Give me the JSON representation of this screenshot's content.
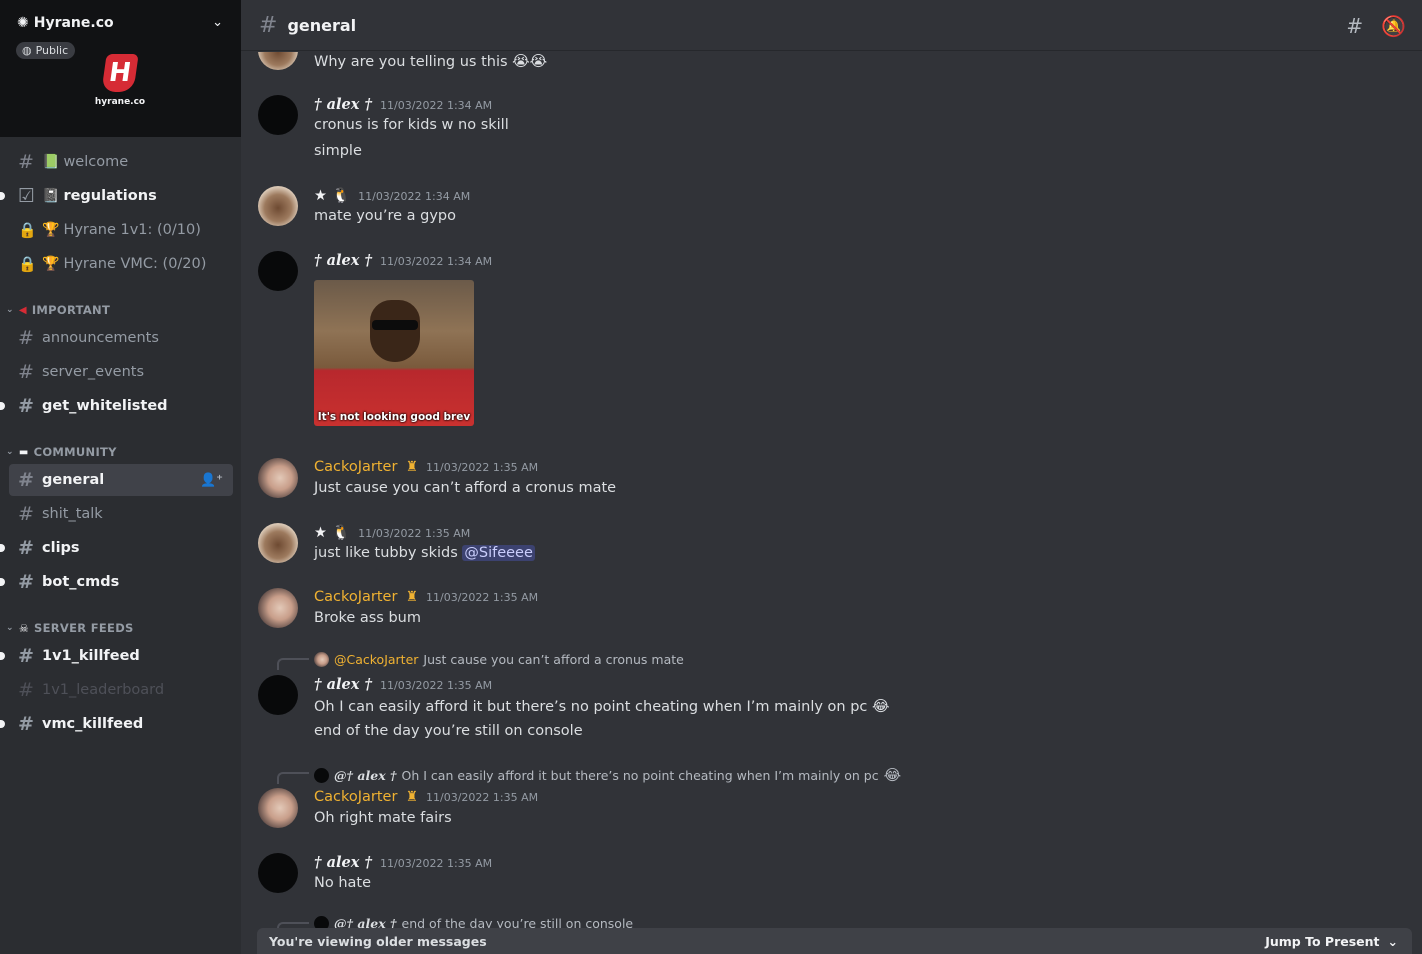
{
  "server": {
    "name": "Hyrane.co",
    "public_label": "Public",
    "logo_text": "hyrane.co"
  },
  "channels": {
    "top": [
      {
        "label": "welcome",
        "emoji": "📗"
      },
      {
        "label": "regulations",
        "emoji": "📓"
      },
      {
        "label": "Hyrane 1v1: (0/10)",
        "emoji": "🏆"
      },
      {
        "label": "Hyrane VMC: (0/20)",
        "emoji": "🏆"
      }
    ],
    "important": {
      "category": "IMPORTANT",
      "items": [
        "announcements",
        "server_events",
        "get_whitelisted"
      ]
    },
    "community": {
      "category": "COMMUNITY",
      "items": [
        "general",
        "shit_talk",
        "clips",
        "bot_cmds"
      ]
    },
    "feeds": {
      "category": "SERVER FEEDS",
      "items": [
        "1v1_killfeed",
        "1v1_leaderboard",
        "vmc_killfeed"
      ]
    }
  },
  "header": {
    "channel": "general"
  },
  "messages": {
    "m0": {
      "text": "Why are you telling us this"
    },
    "m1": {
      "user": "† alex †",
      "time": "11/03/2022 1:34 AM",
      "line1": "cronus is for kids w no skill",
      "line2": "simple"
    },
    "m2": {
      "user": "★ 🐧",
      "time": "11/03/2022 1:34 AM",
      "text": "mate you’re a gypo"
    },
    "m3": {
      "user": "† alex †",
      "time": "11/03/2022 1:34 AM",
      "gif_caption": "It's not looking good brev"
    },
    "m4": {
      "user": "CackoJarter",
      "time": "11/03/2022 1:35 AM",
      "text": "Just cause you can’t afford a cronus mate"
    },
    "m5": {
      "user": "★ 🐧",
      "time": "11/03/2022 1:35 AM",
      "text": "just like tubby skids",
      "mention": "@Sifeeee"
    },
    "m6": {
      "user": "CackoJarter",
      "time": "11/03/2022 1:35 AM",
      "text": "Broke ass bum"
    },
    "m7": {
      "reply_user": "@CackoJarter",
      "reply_text": "Just cause you can’t afford a cronus mate",
      "user": "† alex †",
      "time": "11/03/2022 1:35 AM",
      "line1": "Oh I can easily afford it but there’s no point cheating when I’m mainly on pc",
      "line2": "end of the day you’re still on console"
    },
    "m8": {
      "reply_user": "@† alex †",
      "reply_text": "Oh I can easily afford it but there’s no point cheating when I’m mainly on pc",
      "user": "CackoJarter",
      "time": "11/03/2022 1:35 AM",
      "text": "Oh right mate fairs"
    },
    "m9": {
      "user": "† alex †",
      "time": "11/03/2022 1:35 AM",
      "text": "No hate"
    },
    "m10": {
      "reply_user": "@† alex †",
      "reply_text": "end of the day you’re still on console"
    }
  },
  "footer": {
    "older_label": "You're viewing older messages",
    "jump_label": "Jump To Present"
  },
  "colors": {
    "accent_gold": "#f0b232",
    "brand_red": "#d62b35",
    "mention_bg": "#3c4270"
  }
}
